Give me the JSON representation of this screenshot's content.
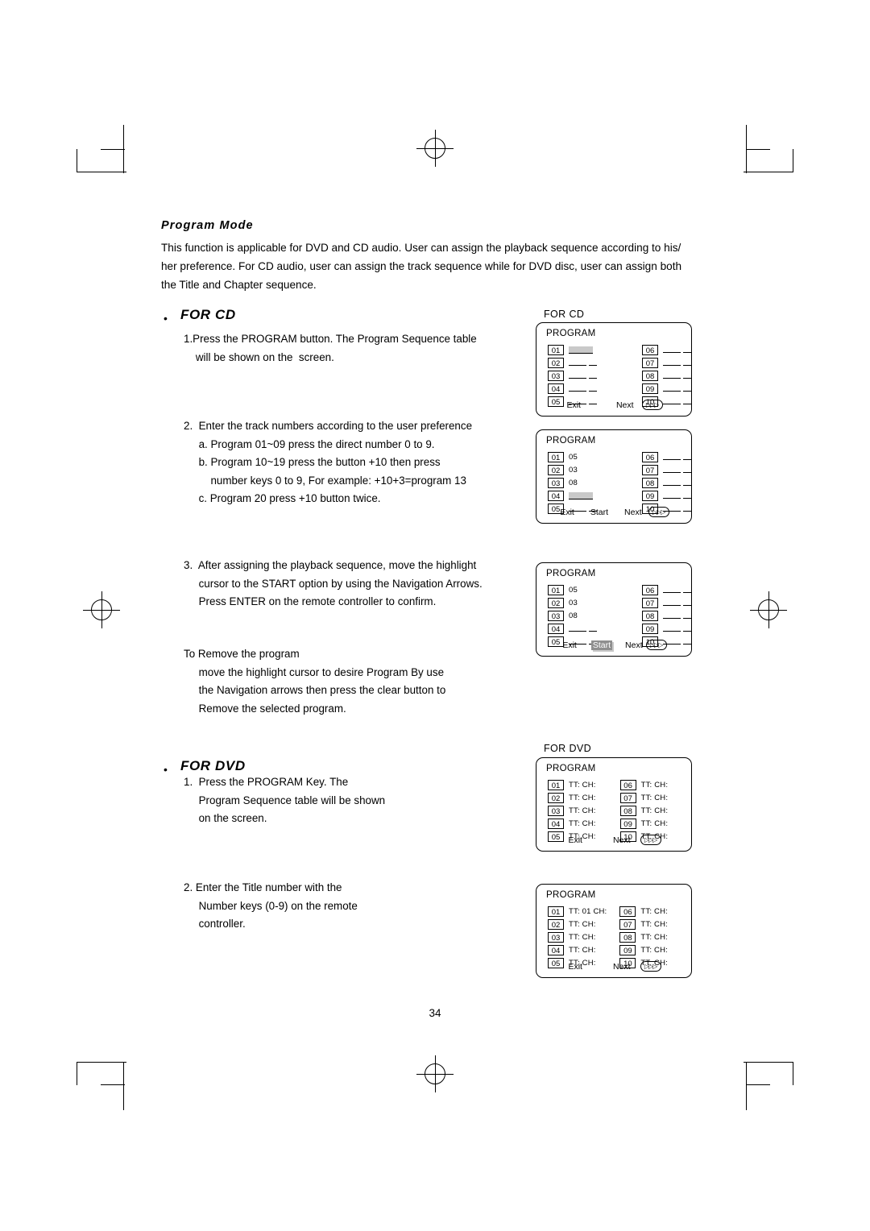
{
  "document": {
    "heading": "Program Mode",
    "intro": "This function is applicable for DVD and CD audio. User can assign the playback sequence according to his/ her preference. For CD audio, user can assign the track sequence while for DVD disc, user can assign both the Title and Chapter sequence.",
    "page_number": "34",
    "sections": [
      {
        "title": "FOR CD",
        "bullet": "•",
        "steps": [
          "1.Press the PROGRAM button. The Program Sequence table\n    will be shown on the  screen.",
          "2.  Enter the track numbers according to the user preference\n     a. Program 01~09 press the direct number 0 to 9.\n     b. Program 10~19 press the button +10 then press\n         number keys 0 to 9, For example: +10+3=program 13\n     c. Program 20 press +10 button twice.",
          "3.  After assigning the playback sequence, move the highlight\n     cursor to the START option by using the Navigation Arrows.\n     Press ENTER on the remote controller to confirm.",
          "To Remove the program\n     move the highlight cursor to desire Program By use\n     the Navigation arrows then press the clear button to\n     Remove the selected program."
        ]
      },
      {
        "title": "FOR DVD",
        "bullet": "•",
        "steps": [
          "1.  Press the PROGRAM Key. The\n     Program Sequence table will be shown\n     on the screen.",
          "2. Enter the Title number with the\n     Number keys (0-9) on the remote\n     controller."
        ]
      }
    ]
  },
  "osd_labels": {
    "cd": "FOR CD",
    "dvd": "FOR DVD"
  },
  "panels": [
    {
      "id": "cd-1",
      "title": "PROGRAM",
      "left_rows": [
        {
          "num": "01",
          "value": "",
          "style": "highlight"
        },
        {
          "num": "02",
          "value": "",
          "style": "blank"
        },
        {
          "num": "03",
          "value": "",
          "style": "blank"
        },
        {
          "num": "04",
          "value": "",
          "style": "blank"
        },
        {
          "num": "05",
          "value": "",
          "style": "blank"
        }
      ],
      "right_rows": [
        {
          "num": "06",
          "value": "",
          "style": "blank"
        },
        {
          "num": "07",
          "value": "",
          "style": "blank"
        },
        {
          "num": "08",
          "value": "",
          "style": "blank"
        },
        {
          "num": "09",
          "value": "",
          "style": "blank"
        },
        {
          "num": "10",
          "value": "",
          "style": "blank"
        }
      ],
      "footer": [
        {
          "label": "Exit",
          "selected": false
        },
        {
          "label": "Next",
          "selected": false
        },
        {
          "label": "▷▷▷",
          "type": "icon",
          "selected": false
        }
      ]
    },
    {
      "id": "cd-2",
      "title": "PROGRAM",
      "left_rows": [
        {
          "num": "01",
          "value": "05",
          "style": "value"
        },
        {
          "num": "02",
          "value": "03",
          "style": "value"
        },
        {
          "num": "03",
          "value": "08",
          "style": "value"
        },
        {
          "num": "04",
          "value": "",
          "style": "highlight"
        },
        {
          "num": "05",
          "value": "",
          "style": "blank"
        }
      ],
      "right_rows": [
        {
          "num": "06",
          "value": "",
          "style": "blank"
        },
        {
          "num": "07",
          "value": "",
          "style": "blank"
        },
        {
          "num": "08",
          "value": "",
          "style": "blank"
        },
        {
          "num": "09",
          "value": "",
          "style": "blank"
        },
        {
          "num": "10",
          "value": "",
          "style": "blank"
        }
      ],
      "footer": [
        {
          "label": "Exit",
          "selected": false
        },
        {
          "label": "Start",
          "selected": false
        },
        {
          "label": "Next",
          "selected": false
        },
        {
          "label": "▷▷▷",
          "type": "icon",
          "selected": false
        }
      ]
    },
    {
      "id": "cd-3",
      "title": "PROGRAM",
      "left_rows": [
        {
          "num": "01",
          "value": "05",
          "style": "value"
        },
        {
          "num": "02",
          "value": "03",
          "style": "value"
        },
        {
          "num": "03",
          "value": "08",
          "style": "value"
        },
        {
          "num": "04",
          "value": "",
          "style": "blank"
        },
        {
          "num": "05",
          "value": "",
          "style": "blank"
        }
      ],
      "right_rows": [
        {
          "num": "06",
          "value": "",
          "style": "blank"
        },
        {
          "num": "07",
          "value": "",
          "style": "blank"
        },
        {
          "num": "08",
          "value": "",
          "style": "blank"
        },
        {
          "num": "09",
          "value": "",
          "style": "blank"
        },
        {
          "num": "10",
          "value": "",
          "style": "blank"
        }
      ],
      "footer": [
        {
          "label": "Exit",
          "selected": false
        },
        {
          "label": "Start",
          "selected": true
        },
        {
          "label": "Next",
          "selected": false
        },
        {
          "label": "▷▷▷",
          "type": "icon",
          "selected": false
        }
      ]
    },
    {
      "id": "dvd-1",
      "title": "PROGRAM",
      "left_rows": [
        {
          "num": "01",
          "value": "TT:  CH:",
          "style": "value"
        },
        {
          "num": "02",
          "value": "TT:  CH:",
          "style": "value"
        },
        {
          "num": "03",
          "value": "TT:  CH:",
          "style": "value"
        },
        {
          "num": "04",
          "value": "TT:  CH:",
          "style": "value"
        },
        {
          "num": "05",
          "value": "TT:  CH:",
          "style": "value"
        }
      ],
      "right_rows": [
        {
          "num": "06",
          "value": "TT:  CH:",
          "style": "value"
        },
        {
          "num": "07",
          "value": "TT:  CH:",
          "style": "value"
        },
        {
          "num": "08",
          "value": "TT:  CH:",
          "style": "value"
        },
        {
          "num": "09",
          "value": "TT:  CH:",
          "style": "value"
        },
        {
          "num": "10",
          "value": "TT:  CH:",
          "style": "value"
        }
      ],
      "footer": [
        {
          "label": "Exit",
          "selected": false
        },
        {
          "label": "Next",
          "selected": false
        },
        {
          "label": "▷▷▷",
          "type": "icon",
          "selected": false
        }
      ]
    },
    {
      "id": "dvd-2",
      "title": "PROGRAM",
      "left_rows": [
        {
          "num": "01",
          "value": "TT: 01 CH:",
          "style": "value"
        },
        {
          "num": "02",
          "value": "TT:  CH:",
          "style": "value"
        },
        {
          "num": "03",
          "value": "TT:  CH:",
          "style": "value"
        },
        {
          "num": "04",
          "value": "TT:  CH:",
          "style": "value"
        },
        {
          "num": "05",
          "value": "TT:  CH:",
          "style": "value"
        }
      ],
      "right_rows": [
        {
          "num": "06",
          "value": "TT:  CH:",
          "style": "value"
        },
        {
          "num": "07",
          "value": "TT:  CH:",
          "style": "value"
        },
        {
          "num": "08",
          "value": "TT:  CH:",
          "style": "value"
        },
        {
          "num": "09",
          "value": "TT:  CH:",
          "style": "value"
        },
        {
          "num": "10",
          "value": "TT:  CH:",
          "style": "value"
        }
      ],
      "footer": [
        {
          "label": "Exit",
          "selected": false
        },
        {
          "label": "Next",
          "selected": false
        },
        {
          "label": "▷▷▷",
          "type": "icon",
          "selected": false
        }
      ]
    }
  ]
}
